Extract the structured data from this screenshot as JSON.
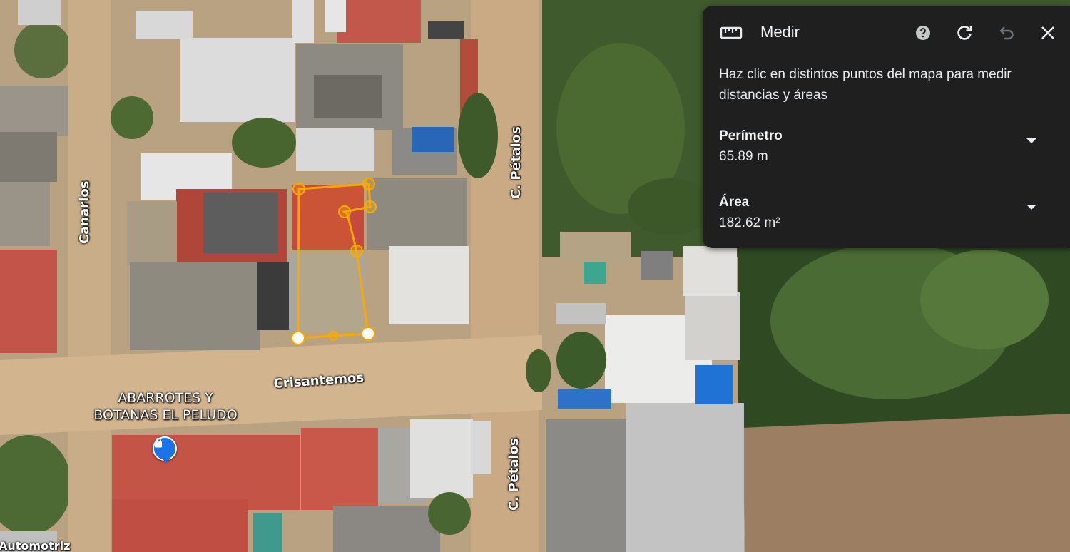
{
  "map": {
    "streets": {
      "canarios": "Canarios",
      "crisantemos": "Crisantemos",
      "petalos_north": "C. Pétalos",
      "petalos_south": "C. Pétalos",
      "automotriz": "Automotriz"
    },
    "poi": {
      "line1": "ABARROTES Y",
      "line2": "BOTANAS EL PELUDO",
      "icon": "shopping-bag-icon",
      "color": "#1a73e8"
    },
    "measurement_color": "#f9ab00"
  },
  "panel": {
    "title": "Medir",
    "icon": "ruler-icon",
    "description": "Haz clic en distintos puntos del mapa para medir distancias y áreas",
    "buttons": {
      "help": "help-icon",
      "reset": "refresh-icon",
      "undo": "undo-icon",
      "close": "close-icon"
    },
    "metrics": [
      {
        "label": "Perímetro",
        "value": "65.89 m"
      },
      {
        "label": "Área",
        "value": "182.62 m²"
      }
    ]
  }
}
